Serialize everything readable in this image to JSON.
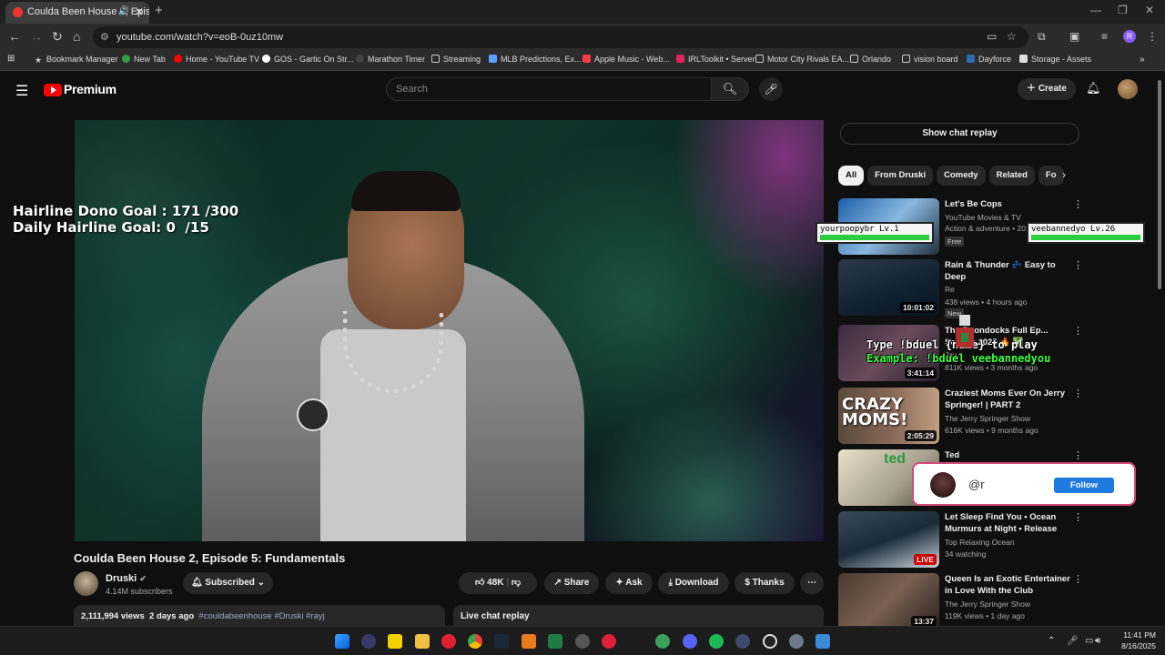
{
  "browser": {
    "tab_title": "Coulda Been House 2, Episo",
    "url": "youtube.com/watch?v=eoB-0uz10mw",
    "profile_initial": "R",
    "bookmarks": [
      "Bookmark Manager",
      "New Tab",
      "Home - YouTube TV",
      "GOS - Gartic On Str...",
      "Marathon Timer",
      "Streaming",
      "MLB Predictions, Ex...",
      "Apple Music - Web...",
      "IRLToolkit • Server",
      "Motor City Rivals EA...",
      "Orlando",
      "vision board",
      "Dayforce",
      "Storage - Assets"
    ]
  },
  "youtube": {
    "brand": "Premium",
    "search_placeholder": "Search",
    "create_label": "Create"
  },
  "video": {
    "overlay_goal": "Hairline Dono Goal : 171 /300\nDaily Hairline Goal: 0  /15",
    "title": "Coulda Been House 2, Episode 5: Fundamentals",
    "channel": "Druski",
    "subscribers": "4.14M subscribers",
    "subscribed_label": "Subscribed",
    "likes": "48K",
    "share_label": "Share",
    "ask_label": "Ask",
    "download_label": "Download",
    "thanks_label": "Thanks",
    "views": "2,111,994 views",
    "age": "2 days ago",
    "tags": "#couldabeenhouse #Druski #rayj",
    "live_chat_replay": "Live chat replay"
  },
  "sidebar": {
    "show_chat_replay": "Show chat replay",
    "chips": [
      "All",
      "From Druski",
      "Comedy",
      "Related",
      "Fo"
    ],
    "recommendations": [
      {
        "title": "Let's Be Cops",
        "channel": "YouTube Movies & TV",
        "meta": "Action & adventure • 201",
        "badge": "Free",
        "duration": ""
      },
      {
        "title": "Rain & Thunder 💤 Easy to Deep",
        "channel": "Re",
        "meta": "438 views • 4 hours ago",
        "badge": "New",
        "duration": "10:01:02"
      },
      {
        "title": "The Boondocks Full Ep... Season 2025 🔥 ✅ ...",
        "channel": "Jay",
        "meta": "811K views • 3 months ago",
        "badge": "",
        "duration": "3:41:14"
      },
      {
        "title": "Craziest Moms Ever On Jerry Springer! | PART 2",
        "channel": "The Jerry Springer Show",
        "meta": "616K views • 9 months ago",
        "badge": "",
        "duration": "2:05:29"
      },
      {
        "title": "Ted",
        "channel": "",
        "meta": "",
        "badge": "",
        "duration": ""
      },
      {
        "title": "Let Sleep Find You • Ocean Murmurs at Night • Release All...",
        "channel": "Top Relaxing Ocean",
        "meta": "34 watching",
        "badge": "",
        "duration": "LIVE"
      },
      {
        "title": "Queen Is an Exotic Entertainer in Love With the Club Promote...",
        "channel": "The Jerry Springer Show",
        "meta": "119K views • 1 day ago",
        "badge": "",
        "duration": "13:37"
      }
    ]
  },
  "stream_overlay": {
    "player1": "yourpoopybr",
    "player1_level": "Lv.1",
    "player1_hp_pct": 1.0,
    "player2": "veebannedyo",
    "player2_level": "Lv.26",
    "player2_hp_pct": 1.0,
    "duel_line1": "Type !bduel {name} to play",
    "duel_line2": "Example: !bduel veebannedyou",
    "follow_handle": "@r",
    "follow_label": "Follow"
  },
  "taskbar": {
    "time": "11:41 PM",
    "date": "8/16/2025"
  }
}
